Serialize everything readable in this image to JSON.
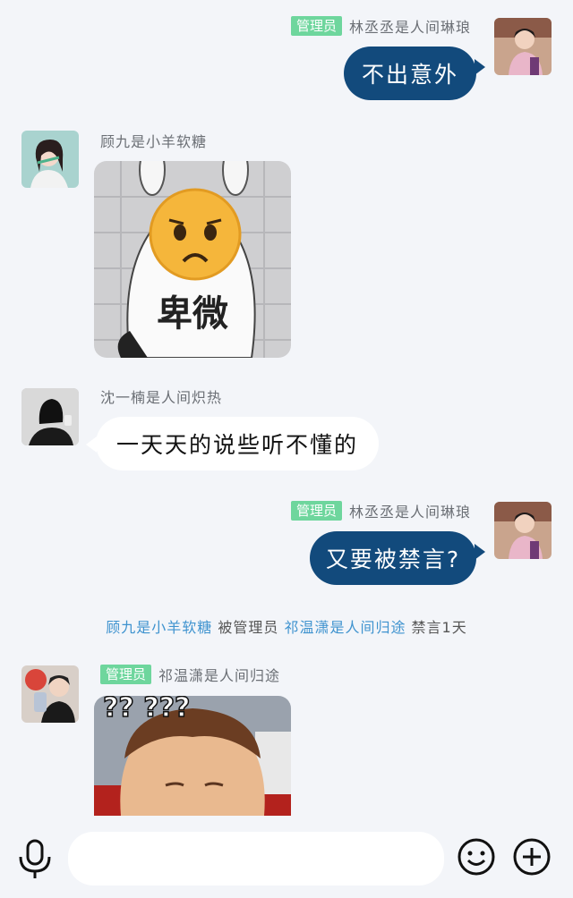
{
  "messages": [
    {
      "direction": "outgoing",
      "badge": "管理员",
      "sender": "林丞丞是人间琳琅",
      "text": "不出意外"
    },
    {
      "direction": "incoming",
      "sender": "顾九是小羊软糖",
      "sticker_caption": "卑微"
    },
    {
      "direction": "incoming",
      "sender": "沈一楠是人间炽热",
      "text": "一天天的说些听不懂的"
    },
    {
      "direction": "outgoing",
      "badge": "管理员",
      "sender": "林丞丞是人间琳琅",
      "text": "又要被禁言?"
    },
    {
      "direction": "incoming",
      "badge": "管理员",
      "sender": "祁温潇是人间归途",
      "sticker_caption": "?? ???"
    }
  ],
  "system_notice": {
    "target": "顾九是小羊软糖",
    "connector": " 被管理员 ",
    "operator": "祁温潇是人间归途",
    "action": " 禁言1天"
  },
  "input_bar": {
    "mic_icon": "microphone-icon",
    "emoji_icon": "smiley-icon",
    "plus_icon": "plus-circle-icon",
    "placeholder": ""
  },
  "colors": {
    "background": "#f3f5f9",
    "outgoing_bubble": "#124a7c",
    "incoming_bubble": "#ffffff",
    "admin_badge": "#6ed69d",
    "link": "#3f93cf"
  }
}
